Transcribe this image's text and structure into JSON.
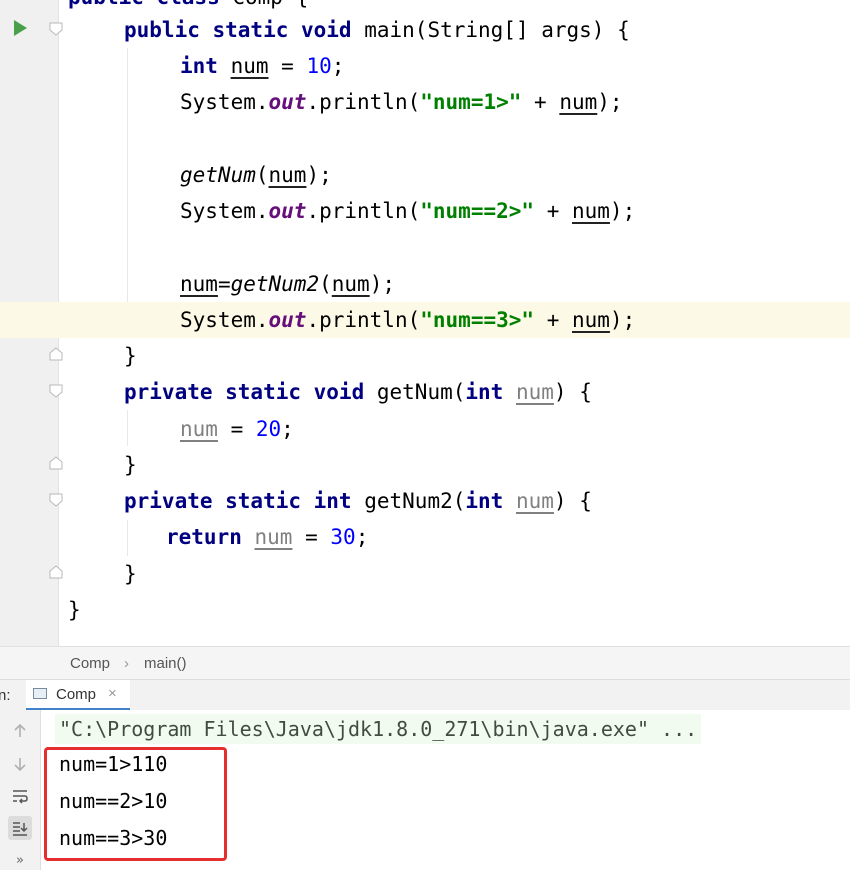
{
  "editor": {
    "line0": {
      "kw": "public class",
      "name": "Comp {"
    },
    "line1": {
      "kw": "public static void",
      "sig": "main(String[] args) {"
    },
    "line2": {
      "kw": "int",
      "var": "num",
      "eq": " = ",
      "val": "10",
      "end": ";"
    },
    "line3": {
      "obj": "System.",
      "field": "out",
      "call": ".println(",
      "str": "\"num=1>\"",
      "plus": " + ",
      "var": "num",
      "end": ");"
    },
    "line5": {
      "fn": "getNum",
      "open": "(",
      "var": "num",
      "end": ");"
    },
    "line6": {
      "obj": "System.",
      "field": "out",
      "call": ".println(",
      "str": "\"num==2>\"",
      "plus": " + ",
      "var": "num",
      "end": ");"
    },
    "line8": {
      "var": "num",
      "eq": "=",
      "fn": "getNum2",
      "open": "(",
      "arg": "num",
      "end": ");"
    },
    "line9": {
      "obj": "System.",
      "field": "out",
      "call": ".println(",
      "str": "\"num==3>\"",
      "plus": " + ",
      "var": "num",
      "end": ");"
    },
    "line10": {
      "text": "}"
    },
    "line11": {
      "kw": "private static void",
      "name": "getNum(",
      "kw2": "int",
      "param": "num",
      "end": ") {"
    },
    "line12": {
      "var": "num",
      "eq": " = ",
      "val": "20",
      "end": ";"
    },
    "line13": {
      "text": "}"
    },
    "line14": {
      "kw": "private static int",
      "name": "getNum2(",
      "kw2": "int",
      "param": "num",
      "end": ") {"
    },
    "line15": {
      "kw": "return",
      "var": "num",
      "eq": " = ",
      "val": "30",
      "end": ";"
    },
    "line16": {
      "text": "}"
    },
    "line17": {
      "text": "}"
    }
  },
  "breadcrumb": {
    "class": "Comp",
    "separator": "›",
    "method": "main()"
  },
  "run": {
    "label_fragment": "n:",
    "tab_label": "Comp",
    "close": "×",
    "command": "\"C:\\Program Files\\Java\\jdk1.8.0_271\\bin\\java.exe\" ...",
    "output": [
      "num=1>110",
      "num==2>10",
      "num==3>30"
    ],
    "toolbar_icons": [
      "arrow-up-icon",
      "arrow-down-icon",
      "soft-wrap-icon",
      "scroll-to-end-icon",
      "more-icon"
    ],
    "more_glyph": "»"
  },
  "colors": {
    "keyword": "#000080",
    "number": "#0000ff",
    "string": "#008000",
    "field": "#660e7a",
    "highlight_box": "#e52f2f",
    "current_line": "#fcfae6"
  }
}
